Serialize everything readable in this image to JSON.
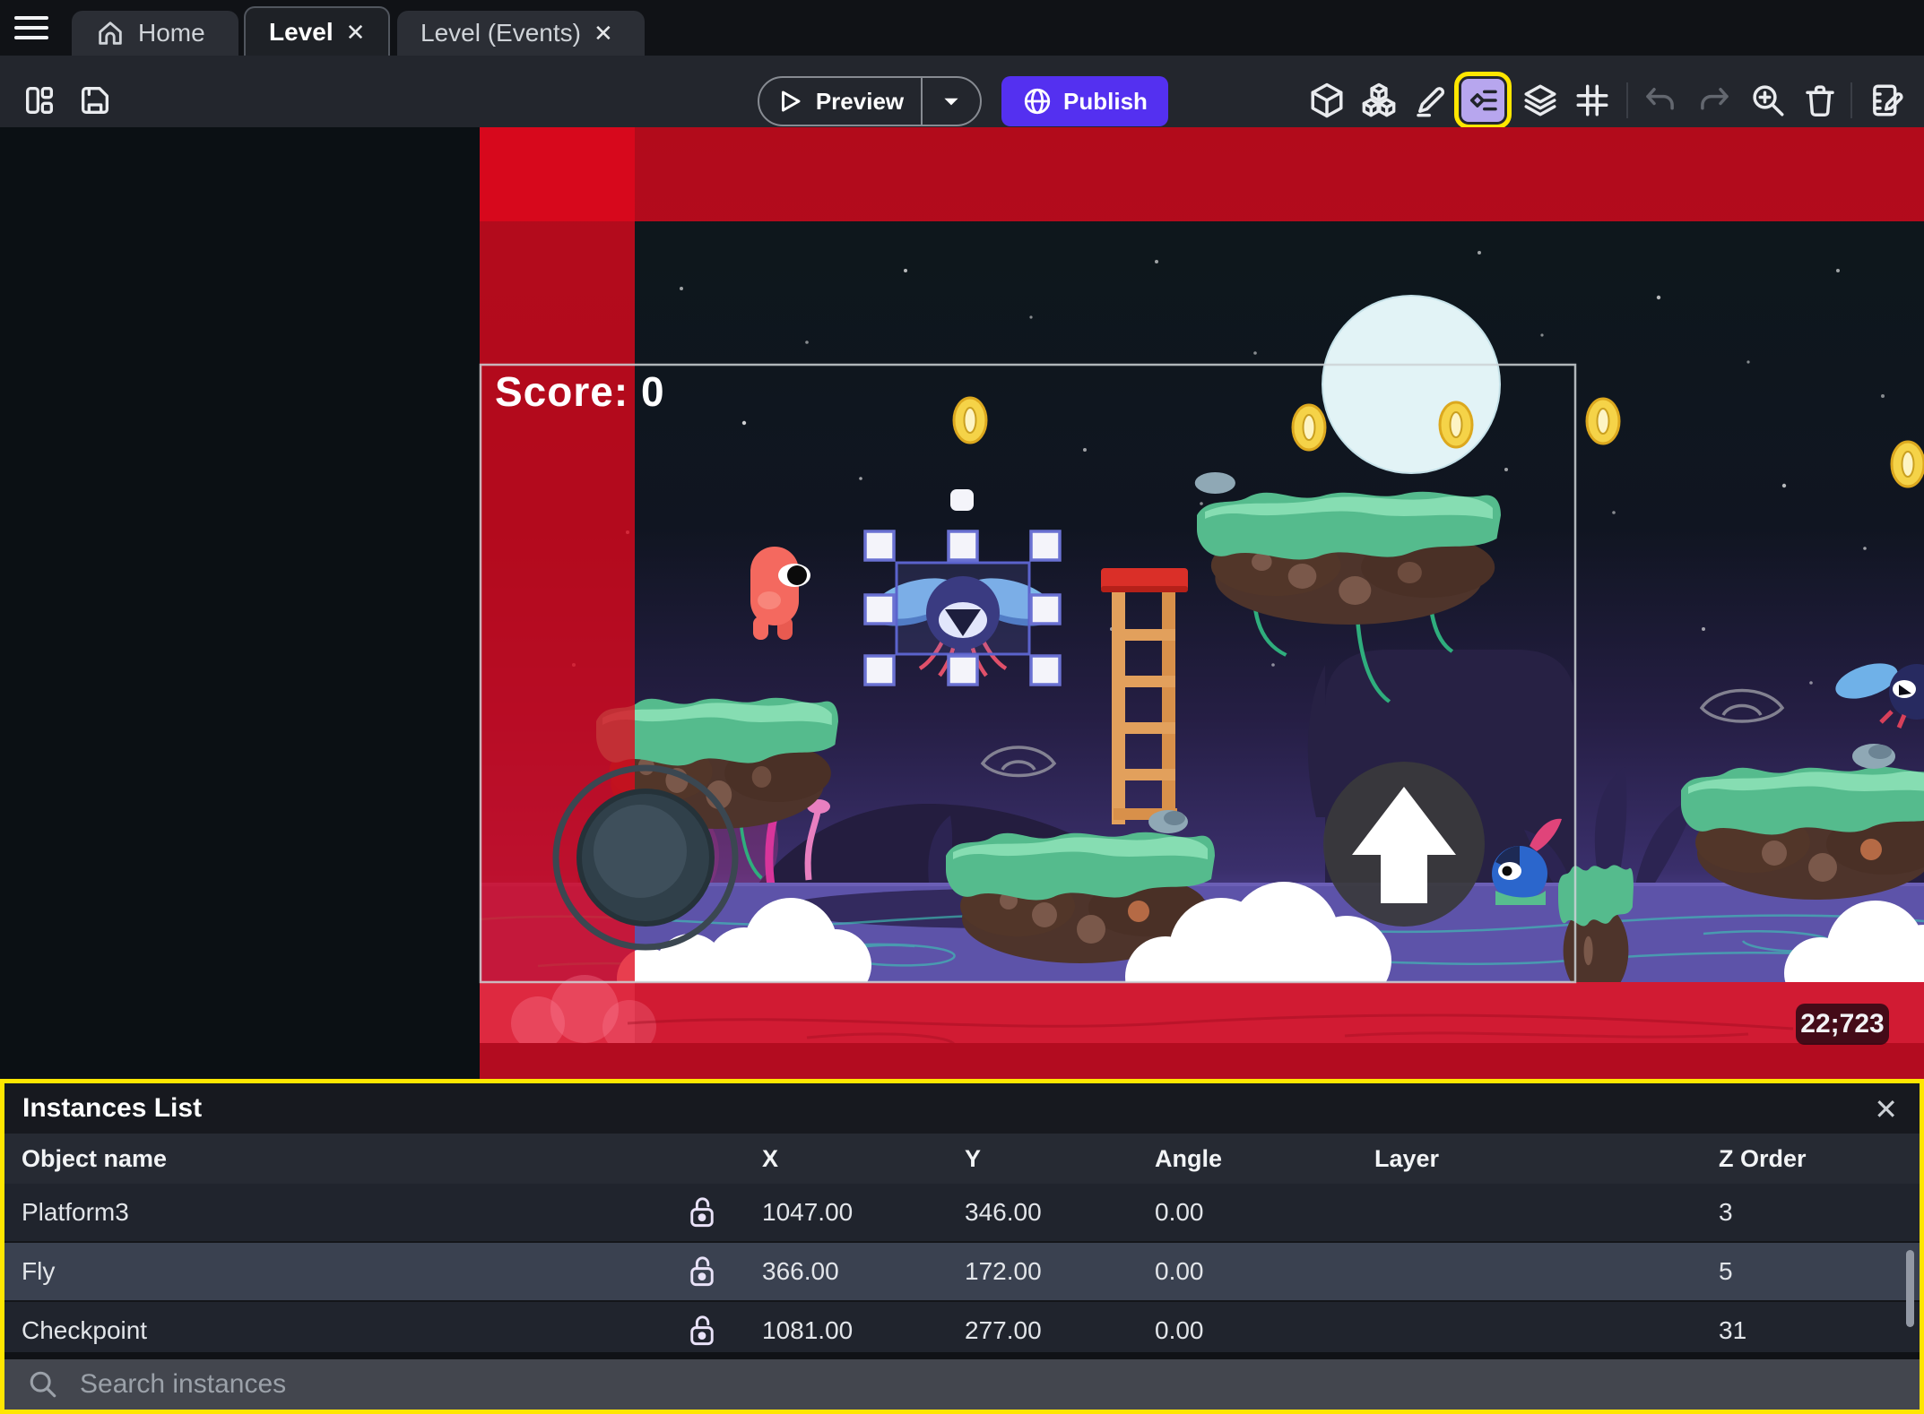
{
  "tabs": {
    "home": "Home",
    "level": "Level",
    "level_events": "Level (Events)"
  },
  "toolbar": {
    "preview_label": "Preview",
    "publish_label": "Publish"
  },
  "scene": {
    "score_text": "Score: 0",
    "coords_badge": "22;723"
  },
  "instances_panel": {
    "title": "Instances List",
    "columns": {
      "object_name": "Object name",
      "x": "X",
      "y": "Y",
      "angle": "Angle",
      "layer": "Layer",
      "z_order": "Z Order"
    },
    "rows": [
      {
        "name": "Platform3",
        "x": "1047.00",
        "y": "346.00",
        "angle": "0.00",
        "layer": "",
        "z_order": "3"
      },
      {
        "name": "Fly",
        "x": "366.00",
        "y": "172.00",
        "angle": "0.00",
        "layer": "",
        "z_order": "5"
      },
      {
        "name": "Checkpoint",
        "x": "1081.00",
        "y": "277.00",
        "angle": "0.00",
        "layer": "",
        "z_order": "31"
      }
    ],
    "search_placeholder": "Search instances",
    "close_glyph": "✕"
  },
  "colors": {
    "highlight_yellow": "#ffe600",
    "publish_purple": "#5430f0",
    "selected_icon_bg": "#b7a6ee",
    "selection_blue": "#5b63cc",
    "red_overlay": "#dd0d20"
  }
}
